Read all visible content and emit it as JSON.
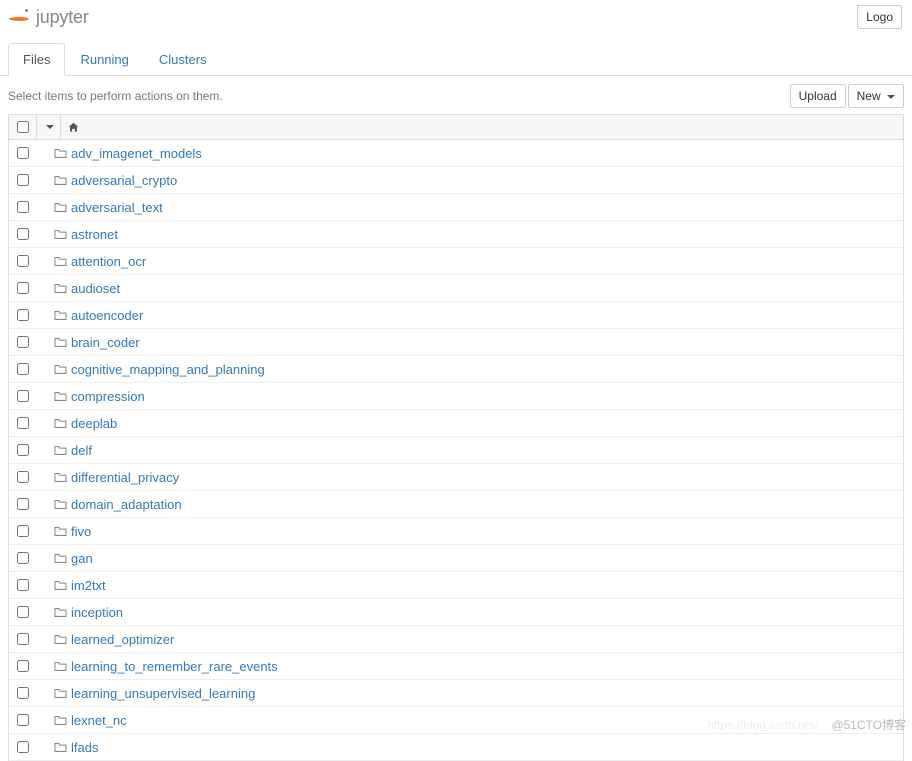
{
  "brand": "jupyter",
  "logout_label": "Logo",
  "tabs": [
    {
      "label": "Files",
      "active": true
    },
    {
      "label": "Running",
      "active": false
    },
    {
      "label": "Clusters",
      "active": false
    }
  ],
  "select_hint": "Select items to perform actions on them.",
  "upload_label": "Upload",
  "new_label": "New",
  "files": [
    {
      "name": "adv_imagenet_models"
    },
    {
      "name": "adversarial_crypto"
    },
    {
      "name": "adversarial_text"
    },
    {
      "name": "astronet"
    },
    {
      "name": "attention_ocr"
    },
    {
      "name": "audioset"
    },
    {
      "name": "autoencoder"
    },
    {
      "name": "brain_coder"
    },
    {
      "name": "cognitive_mapping_and_planning"
    },
    {
      "name": "compression"
    },
    {
      "name": "deeplab"
    },
    {
      "name": "delf"
    },
    {
      "name": "differential_privacy"
    },
    {
      "name": "domain_adaptation"
    },
    {
      "name": "fivo"
    },
    {
      "name": "gan"
    },
    {
      "name": "im2txt"
    },
    {
      "name": "inception"
    },
    {
      "name": "learned_optimizer"
    },
    {
      "name": "learning_to_remember_rare_events"
    },
    {
      "name": "learning_unsupervised_learning"
    },
    {
      "name": "lexnet_nc"
    },
    {
      "name": "lfads"
    }
  ],
  "watermark": "@51CTO博客",
  "watermark_url": "https://blog.csdn.net/"
}
